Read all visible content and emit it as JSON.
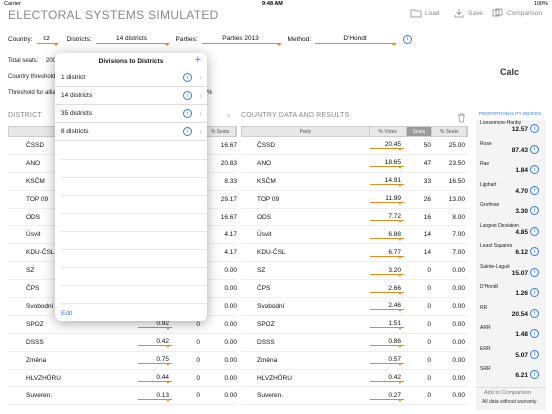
{
  "status": {
    "carrier": "Carrier",
    "time": "9:48 AM",
    "battery": "100%"
  },
  "app": {
    "title": "ELECTORAL SYSTEMS SIMULATED"
  },
  "toolbar": {
    "load": "Load",
    "save": "Save",
    "comparison": "Comparison"
  },
  "selectors": {
    "country_label": "Country:",
    "country": "cz",
    "districts_label": "Districts:",
    "districts": "14 districts",
    "parties_label": "Parties:",
    "parties": "Parties 2013",
    "method_label": "Method:",
    "method": "D'Hondt"
  },
  "info_left": {
    "total_seats_label": "Total seats:",
    "total_seats": "200",
    "country_threshold_label": "Country threshold",
    "threshold_alliance_label": "Threshold for allia",
    "pct": "%"
  },
  "calc": "Calc",
  "sections": {
    "district": "DISTRICT",
    "country": "COUNTRY DATA AND RESULTS",
    "prop": "PROPORTIONALITY INDICES"
  },
  "district_header": {
    "seats": "% Seats"
  },
  "district_rows": [
    {
      "party": "ČSSD",
      "votes": "",
      "seats": "",
      "pct": "16.67"
    },
    {
      "party": "ANO",
      "votes": "",
      "seats": "",
      "pct": "20.83"
    },
    {
      "party": "KSČM",
      "votes": "",
      "seats": "",
      "pct": "8.33"
    },
    {
      "party": "TOP 09",
      "votes": "",
      "seats": "",
      "pct": "29.17"
    },
    {
      "party": "ODS",
      "votes": "",
      "seats": "",
      "pct": "16.67"
    },
    {
      "party": "Úsvit",
      "votes": "",
      "seats": "",
      "pct": "4.17"
    },
    {
      "party": "KDU-ČSL",
      "votes": "",
      "seats": "",
      "pct": "4.17"
    },
    {
      "party": "SZ",
      "votes": "",
      "seats": "",
      "pct": "0.00"
    },
    {
      "party": "ČPS",
      "votes": "",
      "seats": "",
      "pct": "0.00"
    },
    {
      "party": "Svobodní",
      "votes": "",
      "seats": "",
      "pct": "0.00"
    },
    {
      "party": "SPOZ",
      "votes": "0.92",
      "seats": "0",
      "pct": "0.00"
    },
    {
      "party": "DSSS",
      "votes": "0.42",
      "seats": "0",
      "pct": "0.00"
    },
    {
      "party": "Změna",
      "votes": "0.75",
      "seats": "0",
      "pct": "0.00"
    },
    {
      "party": "HLVZHŮRU",
      "votes": "0.44",
      "seats": "0",
      "pct": "0.00"
    },
    {
      "party": "Suveren.",
      "votes": "0.13",
      "seats": "0",
      "pct": "0.00"
    }
  ],
  "country_header": {
    "party": "Party",
    "votes": "% Votes",
    "seats": "Seats",
    "pct": "% Seats"
  },
  "country_rows": [
    {
      "party": "ČSSD",
      "votes": "20.45",
      "seats": "50",
      "pct": "25.00"
    },
    {
      "party": "ANO",
      "votes": "18.65",
      "seats": "47",
      "pct": "23.50"
    },
    {
      "party": "KSČM",
      "votes": "14.91",
      "seats": "33",
      "pct": "16.50"
    },
    {
      "party": "TOP 09",
      "votes": "11.99",
      "seats": "26",
      "pct": "13.00"
    },
    {
      "party": "ODS",
      "votes": "7.72",
      "seats": "16",
      "pct": "8.00"
    },
    {
      "party": "Úsvit",
      "votes": "6.88",
      "seats": "14",
      "pct": "7.00"
    },
    {
      "party": "KDU-ČSL",
      "votes": "6.77",
      "seats": "14",
      "pct": "7.00"
    },
    {
      "party": "SZ",
      "votes": "3.20",
      "seats": "0",
      "pct": "0.00"
    },
    {
      "party": "ČPS",
      "votes": "2.66",
      "seats": "0",
      "pct": "0.00"
    },
    {
      "party": "Svobodní",
      "votes": "2.46",
      "seats": "0",
      "pct": "0.00"
    },
    {
      "party": "SPOZ",
      "votes": "1.51",
      "seats": "0",
      "pct": "0.00"
    },
    {
      "party": "DSSS",
      "votes": "0.86",
      "seats": "0",
      "pct": "0.00"
    },
    {
      "party": "Změna",
      "votes": "0.57",
      "seats": "0",
      "pct": "0.00"
    },
    {
      "party": "HLVZHŮRU",
      "votes": "0.42",
      "seats": "0",
      "pct": "0.00"
    },
    {
      "party": "Suveren.",
      "votes": "0.27",
      "seats": "0",
      "pct": "0.00"
    }
  ],
  "indices": [
    {
      "name": "Loosemore-Hanby",
      "value": "12.57"
    },
    {
      "name": "Rose",
      "value": "87.43"
    },
    {
      "name": "Rae",
      "value": "1.84"
    },
    {
      "name": "Lijphart",
      "value": "4.70"
    },
    {
      "name": "Grofman",
      "value": "3.30"
    },
    {
      "name": "Largest Deviation",
      "value": "4.85"
    },
    {
      "name": "Least Squares",
      "value": "6.12"
    },
    {
      "name": "Sainte-Laguë",
      "value": "15.07"
    },
    {
      "name": "D'Hondt",
      "value": "1.26"
    },
    {
      "name": "RR",
      "value": "20.54"
    },
    {
      "name": "ARR",
      "value": "1.48"
    },
    {
      "name": "ERR",
      "value": "5.07"
    },
    {
      "name": "SRR",
      "value": "6.21"
    }
  ],
  "add_comparison": "Add to Comparison",
  "warranty": "All data without warranty",
  "popover": {
    "title": "Divisions to Districts",
    "items": [
      "1 district",
      "14 districts",
      "35 districts",
      "8 districts"
    ],
    "edit": "Edit"
  }
}
